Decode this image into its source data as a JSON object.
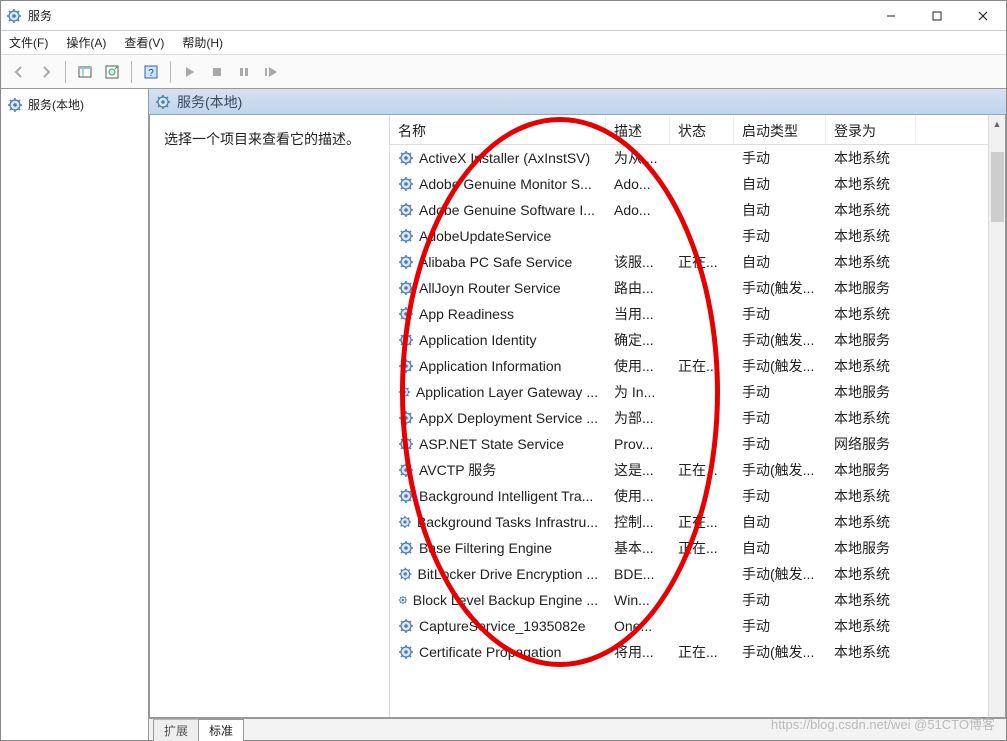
{
  "window_title": "服务",
  "menu": {
    "file": "文件(F)",
    "action": "操作(A)",
    "view": "查看(V)",
    "help": "帮助(H)"
  },
  "tree_root": "服务(本地)",
  "pane_header": "服务(本地)",
  "description_prompt": "选择一个项目来查看它的描述。",
  "columns": {
    "name": "名称",
    "desc": "描述",
    "status": "状态",
    "start": "启动类型",
    "logon": "登录为"
  },
  "tabs": {
    "extended": "扩展",
    "standard": "标准"
  },
  "watermark": "https://blog.csdn.net/wei   @51CTO博客",
  "services": [
    {
      "name": "ActiveX Installer (AxInstSV)",
      "desc": "为从 ...",
      "status": "",
      "start": "手动",
      "logon": "本地系统"
    },
    {
      "name": "Adobe Genuine Monitor S...",
      "desc": "Ado...",
      "status": "",
      "start": "自动",
      "logon": "本地系统"
    },
    {
      "name": "Adobe Genuine Software I...",
      "desc": "Ado...",
      "status": "",
      "start": "自动",
      "logon": "本地系统"
    },
    {
      "name": "AdobeUpdateService",
      "desc": "",
      "status": "",
      "start": "手动",
      "logon": "本地系统"
    },
    {
      "name": "Alibaba PC Safe Service",
      "desc": "该服...",
      "status": "正在...",
      "start": "自动",
      "logon": "本地系统"
    },
    {
      "name": "AllJoyn Router Service",
      "desc": "路由...",
      "status": "",
      "start": "手动(触发...",
      "logon": "本地服务"
    },
    {
      "name": "App Readiness",
      "desc": "当用...",
      "status": "",
      "start": "手动",
      "logon": "本地系统"
    },
    {
      "name": "Application Identity",
      "desc": "确定...",
      "status": "",
      "start": "手动(触发...",
      "logon": "本地服务"
    },
    {
      "name": "Application Information",
      "desc": "使用...",
      "status": "正在...",
      "start": "手动(触发...",
      "logon": "本地系统"
    },
    {
      "name": "Application Layer Gateway ...",
      "desc": "为 In...",
      "status": "",
      "start": "手动",
      "logon": "本地服务"
    },
    {
      "name": "AppX Deployment Service ...",
      "desc": "为部...",
      "status": "",
      "start": "手动",
      "logon": "本地系统"
    },
    {
      "name": "ASP.NET State Service",
      "desc": "Prov...",
      "status": "",
      "start": "手动",
      "logon": "网络服务"
    },
    {
      "name": "AVCTP 服务",
      "desc": "这是...",
      "status": "正在...",
      "start": "手动(触发...",
      "logon": "本地服务"
    },
    {
      "name": "Background Intelligent Tra...",
      "desc": "使用...",
      "status": "",
      "start": "手动",
      "logon": "本地系统"
    },
    {
      "name": "Background Tasks Infrastru...",
      "desc": "控制...",
      "status": "正在...",
      "start": "自动",
      "logon": "本地系统"
    },
    {
      "name": "Base Filtering Engine",
      "desc": "基本...",
      "status": "正在...",
      "start": "自动",
      "logon": "本地服务"
    },
    {
      "name": "BitLocker Drive Encryption ...",
      "desc": "BDE...",
      "status": "",
      "start": "手动(触发...",
      "logon": "本地系统"
    },
    {
      "name": "Block Level Backup Engine ...",
      "desc": "Win...",
      "status": "",
      "start": "手动",
      "logon": "本地系统"
    },
    {
      "name": "CaptureService_1935082e",
      "desc": "One...",
      "status": "",
      "start": "手动",
      "logon": "本地系统"
    },
    {
      "name": "Certificate Propagation",
      "desc": "将用...",
      "status": "正在...",
      "start": "手动(触发...",
      "logon": "本地系统"
    }
  ]
}
